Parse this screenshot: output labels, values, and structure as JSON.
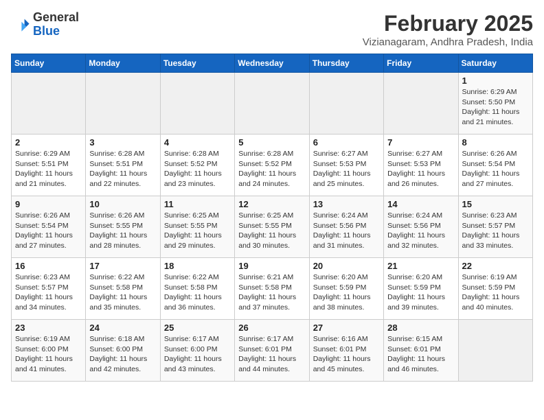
{
  "header": {
    "logo_general": "General",
    "logo_blue": "Blue",
    "month_year": "February 2025",
    "location": "Vizianagaram, Andhra Pradesh, India"
  },
  "weekdays": [
    "Sunday",
    "Monday",
    "Tuesday",
    "Wednesday",
    "Thursday",
    "Friday",
    "Saturday"
  ],
  "weeks": [
    [
      {
        "day": "",
        "info": ""
      },
      {
        "day": "",
        "info": ""
      },
      {
        "day": "",
        "info": ""
      },
      {
        "day": "",
        "info": ""
      },
      {
        "day": "",
        "info": ""
      },
      {
        "day": "",
        "info": ""
      },
      {
        "day": "1",
        "info": "Sunrise: 6:29 AM\nSunset: 5:50 PM\nDaylight: 11 hours\nand 21 minutes."
      }
    ],
    [
      {
        "day": "2",
        "info": "Sunrise: 6:29 AM\nSunset: 5:51 PM\nDaylight: 11 hours\nand 21 minutes."
      },
      {
        "day": "3",
        "info": "Sunrise: 6:28 AM\nSunset: 5:51 PM\nDaylight: 11 hours\nand 22 minutes."
      },
      {
        "day": "4",
        "info": "Sunrise: 6:28 AM\nSunset: 5:52 PM\nDaylight: 11 hours\nand 23 minutes."
      },
      {
        "day": "5",
        "info": "Sunrise: 6:28 AM\nSunset: 5:52 PM\nDaylight: 11 hours\nand 24 minutes."
      },
      {
        "day": "6",
        "info": "Sunrise: 6:27 AM\nSunset: 5:53 PM\nDaylight: 11 hours\nand 25 minutes."
      },
      {
        "day": "7",
        "info": "Sunrise: 6:27 AM\nSunset: 5:53 PM\nDaylight: 11 hours\nand 26 minutes."
      },
      {
        "day": "8",
        "info": "Sunrise: 6:26 AM\nSunset: 5:54 PM\nDaylight: 11 hours\nand 27 minutes."
      }
    ],
    [
      {
        "day": "9",
        "info": "Sunrise: 6:26 AM\nSunset: 5:54 PM\nDaylight: 11 hours\nand 27 minutes."
      },
      {
        "day": "10",
        "info": "Sunrise: 6:26 AM\nSunset: 5:55 PM\nDaylight: 11 hours\nand 28 minutes."
      },
      {
        "day": "11",
        "info": "Sunrise: 6:25 AM\nSunset: 5:55 PM\nDaylight: 11 hours\nand 29 minutes."
      },
      {
        "day": "12",
        "info": "Sunrise: 6:25 AM\nSunset: 5:55 PM\nDaylight: 11 hours\nand 30 minutes."
      },
      {
        "day": "13",
        "info": "Sunrise: 6:24 AM\nSunset: 5:56 PM\nDaylight: 11 hours\nand 31 minutes."
      },
      {
        "day": "14",
        "info": "Sunrise: 6:24 AM\nSunset: 5:56 PM\nDaylight: 11 hours\nand 32 minutes."
      },
      {
        "day": "15",
        "info": "Sunrise: 6:23 AM\nSunset: 5:57 PM\nDaylight: 11 hours\nand 33 minutes."
      }
    ],
    [
      {
        "day": "16",
        "info": "Sunrise: 6:23 AM\nSunset: 5:57 PM\nDaylight: 11 hours\nand 34 minutes."
      },
      {
        "day": "17",
        "info": "Sunrise: 6:22 AM\nSunset: 5:58 PM\nDaylight: 11 hours\nand 35 minutes."
      },
      {
        "day": "18",
        "info": "Sunrise: 6:22 AM\nSunset: 5:58 PM\nDaylight: 11 hours\nand 36 minutes."
      },
      {
        "day": "19",
        "info": "Sunrise: 6:21 AM\nSunset: 5:58 PM\nDaylight: 11 hours\nand 37 minutes."
      },
      {
        "day": "20",
        "info": "Sunrise: 6:20 AM\nSunset: 5:59 PM\nDaylight: 11 hours\nand 38 minutes."
      },
      {
        "day": "21",
        "info": "Sunrise: 6:20 AM\nSunset: 5:59 PM\nDaylight: 11 hours\nand 39 minutes."
      },
      {
        "day": "22",
        "info": "Sunrise: 6:19 AM\nSunset: 5:59 PM\nDaylight: 11 hours\nand 40 minutes."
      }
    ],
    [
      {
        "day": "23",
        "info": "Sunrise: 6:19 AM\nSunset: 6:00 PM\nDaylight: 11 hours\nand 41 minutes."
      },
      {
        "day": "24",
        "info": "Sunrise: 6:18 AM\nSunset: 6:00 PM\nDaylight: 11 hours\nand 42 minutes."
      },
      {
        "day": "25",
        "info": "Sunrise: 6:17 AM\nSunset: 6:00 PM\nDaylight: 11 hours\nand 43 minutes."
      },
      {
        "day": "26",
        "info": "Sunrise: 6:17 AM\nSunset: 6:01 PM\nDaylight: 11 hours\nand 44 minutes."
      },
      {
        "day": "27",
        "info": "Sunrise: 6:16 AM\nSunset: 6:01 PM\nDaylight: 11 hours\nand 45 minutes."
      },
      {
        "day": "28",
        "info": "Sunrise: 6:15 AM\nSunset: 6:01 PM\nDaylight: 11 hours\nand 46 minutes."
      },
      {
        "day": "",
        "info": ""
      }
    ]
  ]
}
